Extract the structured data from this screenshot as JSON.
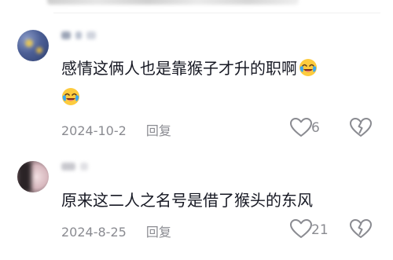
{
  "comments": [
    {
      "line1": "感情这俩人也是靠猴子才升的职啊",
      "date": "2024-10-2",
      "reply_label": "回复",
      "like_count": "6",
      "emoji_icon": "crying-laughing-emoji-icon"
    },
    {
      "line1": "原来这二人之名号是借了猴头的东风",
      "date": "2024-8-25",
      "reply_label": "回复",
      "like_count": "21"
    }
  ]
}
